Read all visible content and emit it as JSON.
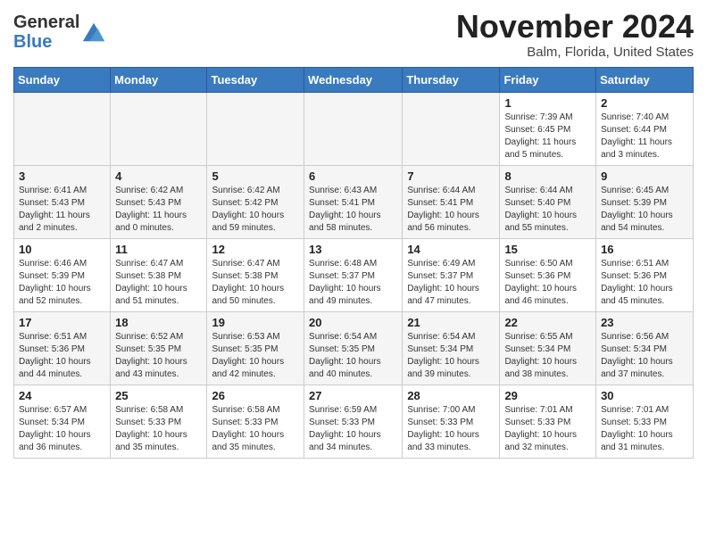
{
  "header": {
    "logo_general": "General",
    "logo_blue": "Blue",
    "month": "November 2024",
    "location": "Balm, Florida, United States"
  },
  "weekdays": [
    "Sunday",
    "Monday",
    "Tuesday",
    "Wednesday",
    "Thursday",
    "Friday",
    "Saturday"
  ],
  "weeks": [
    {
      "shade": false,
      "days": [
        {
          "num": "",
          "info": ""
        },
        {
          "num": "",
          "info": ""
        },
        {
          "num": "",
          "info": ""
        },
        {
          "num": "",
          "info": ""
        },
        {
          "num": "",
          "info": ""
        },
        {
          "num": "1",
          "info": "Sunrise: 7:39 AM\nSunset: 6:45 PM\nDaylight: 11 hours\nand 5 minutes."
        },
        {
          "num": "2",
          "info": "Sunrise: 7:40 AM\nSunset: 6:44 PM\nDaylight: 11 hours\nand 3 minutes."
        }
      ]
    },
    {
      "shade": true,
      "days": [
        {
          "num": "3",
          "info": "Sunrise: 6:41 AM\nSunset: 5:43 PM\nDaylight: 11 hours\nand 2 minutes."
        },
        {
          "num": "4",
          "info": "Sunrise: 6:42 AM\nSunset: 5:43 PM\nDaylight: 11 hours\nand 0 minutes."
        },
        {
          "num": "5",
          "info": "Sunrise: 6:42 AM\nSunset: 5:42 PM\nDaylight: 10 hours\nand 59 minutes."
        },
        {
          "num": "6",
          "info": "Sunrise: 6:43 AM\nSunset: 5:41 PM\nDaylight: 10 hours\nand 58 minutes."
        },
        {
          "num": "7",
          "info": "Sunrise: 6:44 AM\nSunset: 5:41 PM\nDaylight: 10 hours\nand 56 minutes."
        },
        {
          "num": "8",
          "info": "Sunrise: 6:44 AM\nSunset: 5:40 PM\nDaylight: 10 hours\nand 55 minutes."
        },
        {
          "num": "9",
          "info": "Sunrise: 6:45 AM\nSunset: 5:39 PM\nDaylight: 10 hours\nand 54 minutes."
        }
      ]
    },
    {
      "shade": false,
      "days": [
        {
          "num": "10",
          "info": "Sunrise: 6:46 AM\nSunset: 5:39 PM\nDaylight: 10 hours\nand 52 minutes."
        },
        {
          "num": "11",
          "info": "Sunrise: 6:47 AM\nSunset: 5:38 PM\nDaylight: 10 hours\nand 51 minutes."
        },
        {
          "num": "12",
          "info": "Sunrise: 6:47 AM\nSunset: 5:38 PM\nDaylight: 10 hours\nand 50 minutes."
        },
        {
          "num": "13",
          "info": "Sunrise: 6:48 AM\nSunset: 5:37 PM\nDaylight: 10 hours\nand 49 minutes."
        },
        {
          "num": "14",
          "info": "Sunrise: 6:49 AM\nSunset: 5:37 PM\nDaylight: 10 hours\nand 47 minutes."
        },
        {
          "num": "15",
          "info": "Sunrise: 6:50 AM\nSunset: 5:36 PM\nDaylight: 10 hours\nand 46 minutes."
        },
        {
          "num": "16",
          "info": "Sunrise: 6:51 AM\nSunset: 5:36 PM\nDaylight: 10 hours\nand 45 minutes."
        }
      ]
    },
    {
      "shade": true,
      "days": [
        {
          "num": "17",
          "info": "Sunrise: 6:51 AM\nSunset: 5:36 PM\nDaylight: 10 hours\nand 44 minutes."
        },
        {
          "num": "18",
          "info": "Sunrise: 6:52 AM\nSunset: 5:35 PM\nDaylight: 10 hours\nand 43 minutes."
        },
        {
          "num": "19",
          "info": "Sunrise: 6:53 AM\nSunset: 5:35 PM\nDaylight: 10 hours\nand 42 minutes."
        },
        {
          "num": "20",
          "info": "Sunrise: 6:54 AM\nSunset: 5:35 PM\nDaylight: 10 hours\nand 40 minutes."
        },
        {
          "num": "21",
          "info": "Sunrise: 6:54 AM\nSunset: 5:34 PM\nDaylight: 10 hours\nand 39 minutes."
        },
        {
          "num": "22",
          "info": "Sunrise: 6:55 AM\nSunset: 5:34 PM\nDaylight: 10 hours\nand 38 minutes."
        },
        {
          "num": "23",
          "info": "Sunrise: 6:56 AM\nSunset: 5:34 PM\nDaylight: 10 hours\nand 37 minutes."
        }
      ]
    },
    {
      "shade": false,
      "days": [
        {
          "num": "24",
          "info": "Sunrise: 6:57 AM\nSunset: 5:34 PM\nDaylight: 10 hours\nand 36 minutes."
        },
        {
          "num": "25",
          "info": "Sunrise: 6:58 AM\nSunset: 5:33 PM\nDaylight: 10 hours\nand 35 minutes."
        },
        {
          "num": "26",
          "info": "Sunrise: 6:58 AM\nSunset: 5:33 PM\nDaylight: 10 hours\nand 35 minutes."
        },
        {
          "num": "27",
          "info": "Sunrise: 6:59 AM\nSunset: 5:33 PM\nDaylight: 10 hours\nand 34 minutes."
        },
        {
          "num": "28",
          "info": "Sunrise: 7:00 AM\nSunset: 5:33 PM\nDaylight: 10 hours\nand 33 minutes."
        },
        {
          "num": "29",
          "info": "Sunrise: 7:01 AM\nSunset: 5:33 PM\nDaylight: 10 hours\nand 32 minutes."
        },
        {
          "num": "30",
          "info": "Sunrise: 7:01 AM\nSunset: 5:33 PM\nDaylight: 10 hours\nand 31 minutes."
        }
      ]
    }
  ]
}
